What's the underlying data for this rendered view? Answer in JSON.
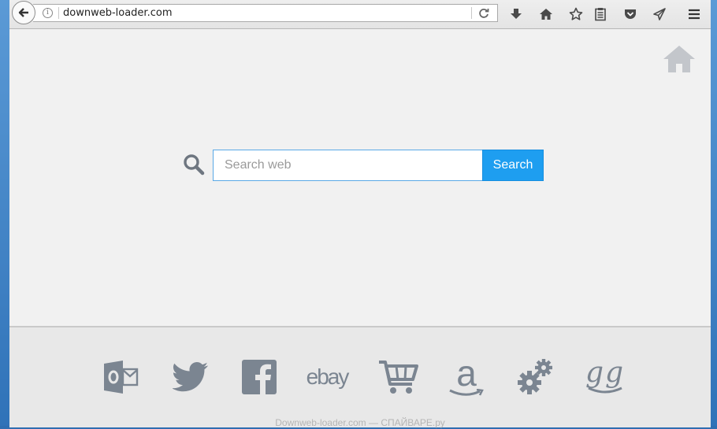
{
  "browser": {
    "url": "downweb-loader.com",
    "toolbar_icons": [
      "download-icon",
      "home-icon",
      "bookmark-star-icon",
      "reading-list-icon",
      "pocket-icon",
      "send-icon",
      "menu-icon"
    ]
  },
  "search": {
    "placeholder": "Search web",
    "button_label": "Search"
  },
  "shortcuts": [
    {
      "name": "outlook",
      "icon": "outlook-icon"
    },
    {
      "name": "twitter",
      "icon": "twitter-icon"
    },
    {
      "name": "facebook",
      "icon": "facebook-icon"
    },
    {
      "name": "ebay",
      "icon": "ebay-icon",
      "text": "ebay"
    },
    {
      "name": "shopping",
      "icon": "cart-icon"
    },
    {
      "name": "amazon",
      "icon": "amazon-icon",
      "text": "a"
    },
    {
      "name": "settings",
      "icon": "gears-icon"
    },
    {
      "name": "google",
      "icon": "gg-icon",
      "text": "gg"
    }
  ],
  "footer": {
    "caption": "Downweb-loader.com — СПАЙВАРЕ.ру"
  },
  "colors": {
    "accent": "#1e9ef0",
    "icon_gray": "#7b8591",
    "page_bg": "#f1f1f1"
  }
}
